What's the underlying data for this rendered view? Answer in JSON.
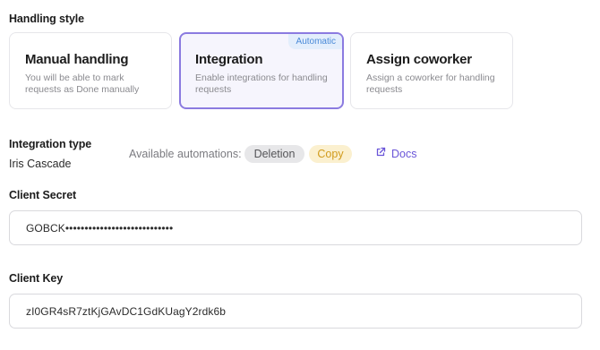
{
  "handling_style": {
    "label": "Handling style",
    "cards": [
      {
        "title": "Manual handling",
        "description": "You will be able to mark requests as Done manually"
      },
      {
        "title": "Integration",
        "description": "Enable integrations for handling requests",
        "badge": "Automatic",
        "selected": true
      },
      {
        "title": "Assign coworker",
        "description": "Assign a coworker for handling requests"
      }
    ]
  },
  "integration_type": {
    "label": "Integration type",
    "value": "Iris Cascade",
    "automations_label": "Available automations:",
    "automations": [
      {
        "label": "Deletion",
        "color": "#e7e7e9"
      },
      {
        "label": "Copy",
        "color": "#fbf0cf"
      }
    ],
    "docs_link": "Docs",
    "docs_icon": "external-link-icon"
  },
  "client_secret": {
    "label": "Client Secret",
    "value": "GOBCK••••••••••••••••••••••••••••"
  },
  "client_key": {
    "label": "Client Key",
    "value": "zI0GR4sR7ztKjGAvDC1GdKUagY2rdk6b"
  },
  "colors": {
    "accent": "#6a55d8",
    "selected_border": "#8b7be0",
    "badge_text": "#4a8ad8"
  }
}
